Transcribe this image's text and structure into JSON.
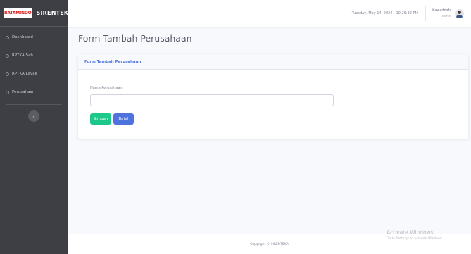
{
  "brand": {
    "logo_text": "BATAMINDO",
    "app_name": "SIRENTEKA"
  },
  "sidebar": {
    "items": [
      {
        "label": "Dashboard",
        "icon": "circle-icon"
      },
      {
        "label": "RPTKA Sah",
        "icon": "circle-icon"
      },
      {
        "label": "RPTKA Layak",
        "icon": "circle-icon"
      },
      {
        "label": "Perusahaan",
        "icon": "circle-icon"
      }
    ],
    "toggle_icon": "chevron-left-icon",
    "toggle_glyph": "‹"
  },
  "topbar": {
    "datetime": "Tuesday, May 14, 2024 - 10:25:32 PM",
    "user_name": "Mawaddah",
    "user_role": "Admin"
  },
  "page": {
    "title": "Form Tambah Perusahaan"
  },
  "card": {
    "header": "Form Tambah Perusahaan",
    "field_label": "Nama Perusahaan",
    "field_value": "",
    "save_label": "Simpan",
    "cancel_label": "Batal"
  },
  "footer": {
    "copyright": "Copyright © SIRENTEKA"
  },
  "watermark": {
    "title": "Activate Windows",
    "subtitle": "Go to Settings to activate Windows."
  },
  "colors": {
    "sidebar_bg": "#3d3f44",
    "primary": "#4e73df",
    "success": "#1cc88a"
  }
}
